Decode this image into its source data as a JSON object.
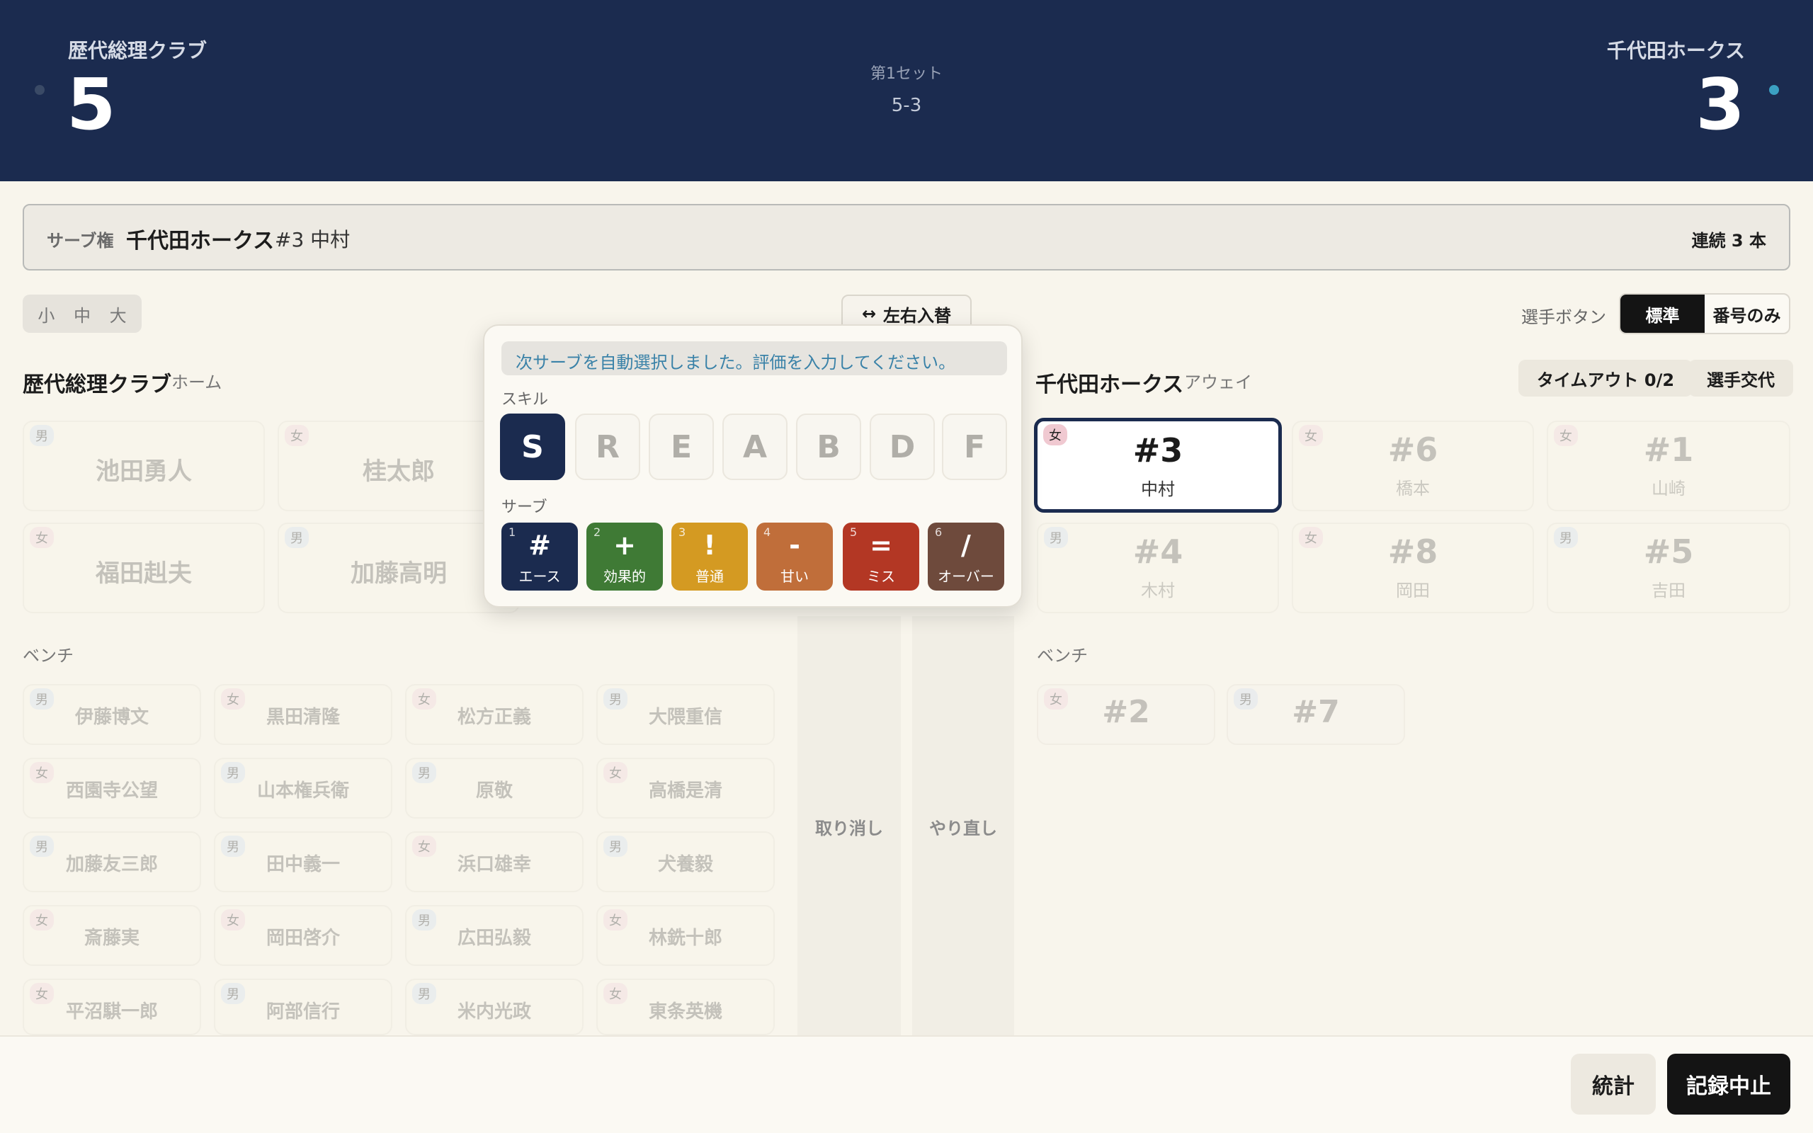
{
  "scoreboard": {
    "home_team": "歴代総理クラブ",
    "home_score": "5",
    "away_team": "千代田ホークス",
    "away_score": "3",
    "set_label": "第1セット",
    "set_score": "5-3",
    "home_dot_color": "#3a4a66",
    "away_dot_color": "#3ba0c2"
  },
  "serve": {
    "label": "サーブ権",
    "team": "千代田ホークス",
    "player": "#3 中村",
    "streak": "連続 3 本"
  },
  "size_toggle": [
    "小",
    "中",
    "大"
  ],
  "swap": {
    "icon": "↔",
    "label": "左右入替"
  },
  "player_button": {
    "label": "選手ボタン",
    "options": [
      "標準",
      "番号のみ"
    ],
    "selected": "標準"
  },
  "home": {
    "name": "歴代総理クラブ",
    "role": "ホーム",
    "court": [
      {
        "g": "男",
        "name": "池田勇人"
      },
      {
        "g": "女",
        "name": "桂太郎"
      },
      {
        "g": "女",
        "name": "福田赳夫"
      },
      {
        "g": "男",
        "name": "加藤高明"
      }
    ],
    "bench_label": "ベンチ",
    "bench": [
      {
        "g": "男",
        "name": "伊藤博文"
      },
      {
        "g": "女",
        "name": "黒田清隆"
      },
      {
        "g": "女",
        "name": "松方正義"
      },
      {
        "g": "男",
        "name": "大隈重信"
      },
      {
        "g": "女",
        "name": "西園寺公望"
      },
      {
        "g": "男",
        "name": "山本権兵衛"
      },
      {
        "g": "男",
        "name": "原敬"
      },
      {
        "g": "女",
        "name": "高橋是清"
      },
      {
        "g": "男",
        "name": "加藤友三郎"
      },
      {
        "g": "男",
        "name": "田中義一"
      },
      {
        "g": "女",
        "name": "浜口雄幸"
      },
      {
        "g": "男",
        "name": "犬養毅"
      },
      {
        "g": "女",
        "name": "斎藤実"
      },
      {
        "g": "女",
        "name": "岡田啓介"
      },
      {
        "g": "男",
        "name": "広田弘毅"
      },
      {
        "g": "女",
        "name": "林銑十郎"
      },
      {
        "g": "女",
        "name": "平沼騏一郎"
      },
      {
        "g": "男",
        "name": "阿部信行"
      },
      {
        "g": "男",
        "name": "米内光政"
      },
      {
        "g": "女",
        "name": "東条英機"
      }
    ]
  },
  "away": {
    "name": "千代田ホークス",
    "role": "アウェイ",
    "timeout": "タイムアウト 0/2",
    "sub": "選手交代",
    "court": [
      {
        "g": "女",
        "num": "#3",
        "name": "中村"
      },
      {
        "g": "女",
        "num": "#6",
        "name": "橋本"
      },
      {
        "g": "女",
        "num": "#1",
        "name": "山崎"
      },
      {
        "g": "男",
        "num": "#4",
        "name": "木村"
      },
      {
        "g": "女",
        "num": "#8",
        "name": "岡田"
      },
      {
        "g": "男",
        "num": "#5",
        "name": "吉田"
      }
    ],
    "bench_label": "ベンチ",
    "bench": [
      {
        "g": "女",
        "num": "#2"
      },
      {
        "g": "男",
        "num": "#7"
      }
    ]
  },
  "undo": "取り消し",
  "redo": "やり直し",
  "popup": {
    "message": "次サーブを自動選択しました。評価を入力してください。",
    "skill_label": "スキル",
    "skills": [
      "S",
      "R",
      "E",
      "A",
      "B",
      "D",
      "F"
    ],
    "selected_skill": "S",
    "serve_label": "サーブ",
    "evals": [
      {
        "key": "1",
        "sym": "#",
        "text": "エース",
        "color": "#1b2b4f"
      },
      {
        "key": "2",
        "sym": "+",
        "text": "効果的",
        "color": "#3f7a35"
      },
      {
        "key": "3",
        "sym": "!",
        "text": "普通",
        "color": "#d49a22"
      },
      {
        "key": "4",
        "sym": "-",
        "text": "甘い",
        "color": "#c06e3a"
      },
      {
        "key": "5",
        "sym": "=",
        "text": "ミス",
        "color": "#b33724"
      },
      {
        "key": "6",
        "sym": "/",
        "text": "オーバー",
        "color": "#6e4a3c"
      }
    ]
  },
  "footer": {
    "stats": "統計",
    "stop": "記録中止"
  }
}
